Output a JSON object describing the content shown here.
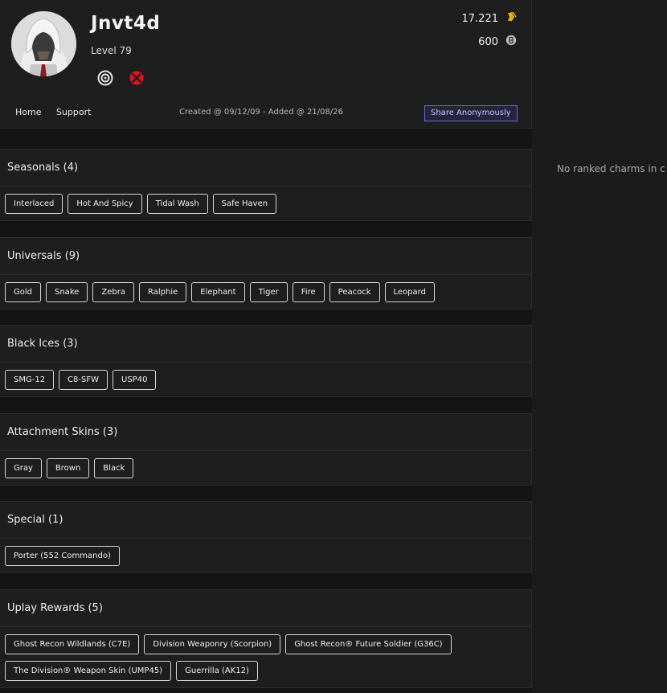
{
  "profile": {
    "username": "Jnvt4d",
    "level": "Level 79",
    "renown": "17.221",
    "credits": "600",
    "platforms": [
      "uplay-icon",
      "xbox-icon"
    ]
  },
  "nav": {
    "home": "Home",
    "support": "Support",
    "created": "Created @ 09/12/09 - Added @ 21/08/26",
    "share": "Share Anonymously"
  },
  "sections": {
    "seasonals": {
      "title": "Seasonals (4)",
      "items": [
        "Interlaced",
        "Hot And Spicy",
        "Tidal Wash",
        "Safe Haven"
      ]
    },
    "universals": {
      "title": "Universals (9)",
      "items": [
        "Gold",
        "Snake",
        "Zebra",
        "Ralphie",
        "Elephant",
        "Tiger",
        "Fire",
        "Peacock",
        "Leopard"
      ]
    },
    "black_ices": {
      "title": "Black Ices (3)",
      "items": [
        "SMG-12",
        "C8-SFW",
        "USP40"
      ]
    },
    "attachment_skins": {
      "title": "Attachment Skins (3)",
      "items": [
        "Gray",
        "Brown",
        "Black"
      ]
    },
    "special": {
      "title": "Special (1)",
      "items": [
        "Porter (552 Commando)"
      ]
    },
    "uplay_rewards": {
      "title": "Uplay Rewards (5)",
      "items": [
        "Ghost Recon Wildlands (C7E)",
        "Division Weaponry (Scorpion)",
        "Ghost Recon® Future Soldier (G36C)",
        "The Division® Weapon Skin (UMP45)",
        "Guerrilla (AK12)"
      ]
    }
  },
  "sidebar": {
    "message": "No ranked charms in c"
  },
  "colors": {
    "background": "#141414",
    "panel": "#1e1e1f",
    "share_border": "#6a6ad6",
    "xbox_red": "#e0141e",
    "renown_gold": "#e2b21c"
  }
}
